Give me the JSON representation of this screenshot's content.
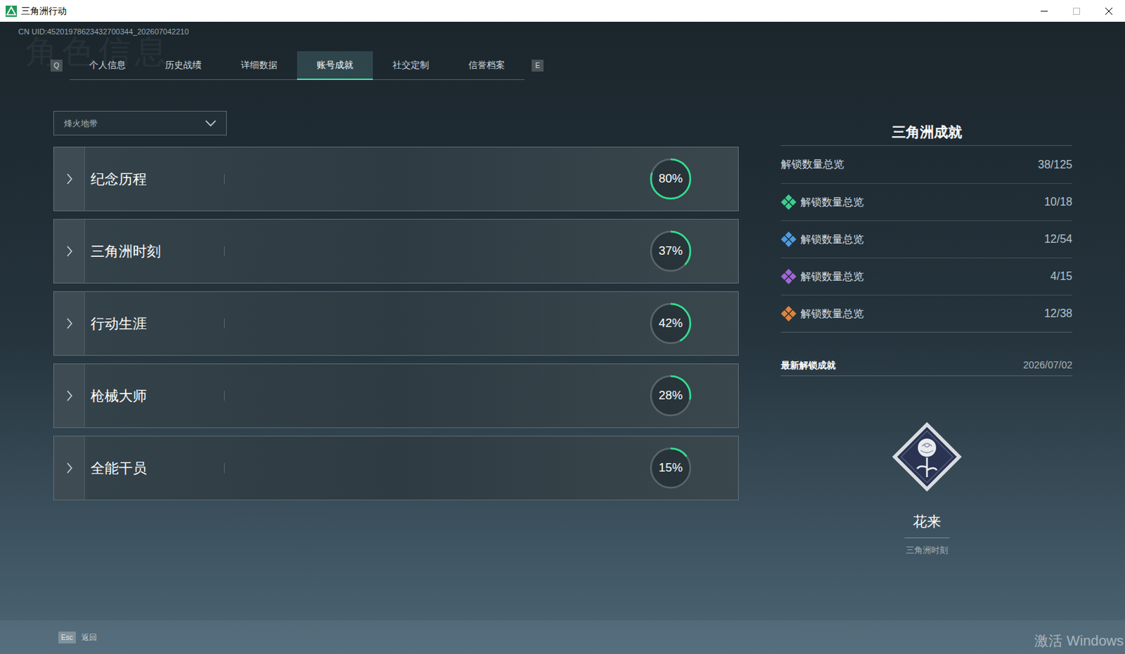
{
  "window": {
    "title": "三角洲行动"
  },
  "uid": "CN UID:45201978623432700344_202607042210",
  "watermark": "角色信息",
  "tabs": {
    "prev_key": "Q",
    "next_key": "E",
    "items": [
      {
        "label": "个人信息",
        "selected": false
      },
      {
        "label": "历史战绩",
        "selected": false
      },
      {
        "label": "详细数据",
        "selected": false
      },
      {
        "label": "账号成就",
        "selected": true
      },
      {
        "label": "社交定制",
        "selected": false
      },
      {
        "label": "信誉档案",
        "selected": false
      }
    ]
  },
  "mode_dropdown": {
    "value": "烽火地带"
  },
  "categories": [
    {
      "label": "纪念历程",
      "reading": "80%",
      "level": 0.8
    },
    {
      "label": "三角洲时刻",
      "reading": "37%",
      "level": 0.37
    },
    {
      "label": "行动生涯",
      "reading": "42%",
      "level": 0.42
    },
    {
      "label": "枪械大师",
      "reading": "28%",
      "level": 0.28
    },
    {
      "label": "全能干员",
      "reading": "15%",
      "level": 0.15
    }
  ],
  "summary": {
    "title": "三角洲成就",
    "total": {
      "label": "解锁数量总览",
      "value": "38/125"
    },
    "tiers": [
      {
        "label": "解锁数量总览",
        "value": "10/18",
        "color": "#3ccf8e"
      },
      {
        "label": "解锁数量总览",
        "value": "12/54",
        "color": "#4f9be0"
      },
      {
        "label": "解锁数量总览",
        "value": "4/15",
        "color": "#a266d8"
      },
      {
        "label": "解锁数量总览",
        "value": "12/38",
        "color": "#e0853c"
      }
    ]
  },
  "latest": {
    "label": "最新解锁成就",
    "date": "2026/07/02",
    "name": "花来",
    "category": "三角洲时刻"
  },
  "footer": {
    "key": "Esc",
    "label": "返回"
  },
  "os_watermark": "激活 Windows"
}
